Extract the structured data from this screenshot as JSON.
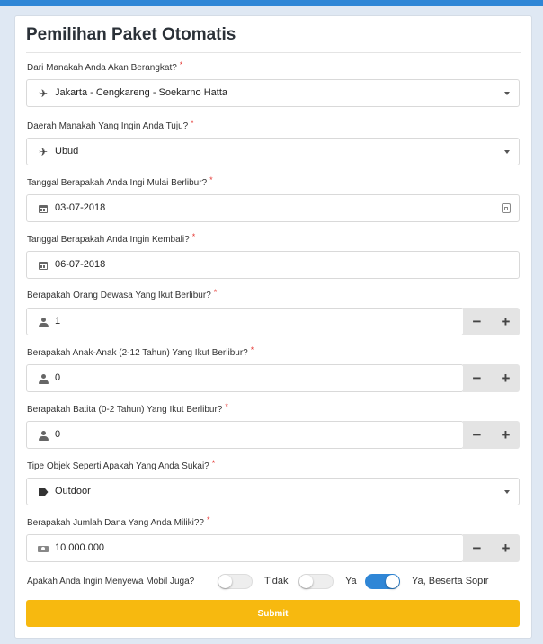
{
  "title": "Pemilihan Paket Otomatis",
  "required_mark": "*",
  "fields": {
    "departure": {
      "label": "Dari Manakah Anda Akan Berangkat?",
      "value": "Jakarta - Cengkareng - Soekarno Hatta",
      "icon": "plane-icon"
    },
    "destination": {
      "label": "Daerah Manakah Yang Ingin Anda Tuju?",
      "value": "Ubud",
      "icon": "plane-icon"
    },
    "start_date": {
      "label": "Tanggal Berapakah Anda Ingi Mulai Berlibur?",
      "value": "03-07-2018",
      "icon": "calendar-icon"
    },
    "end_date": {
      "label": "Tanggal Berapakah Anda Ingin Kembali?",
      "value": "06-07-2018",
      "icon": "calendar-icon"
    },
    "adults": {
      "label": "Berapakah Orang Dewasa Yang Ikut Berlibur?",
      "value": "1",
      "icon": "user-icon"
    },
    "children": {
      "label": "Berapakah Anak-Anak (2-12 Tahun) Yang Ikut Berlibur?",
      "value": "0",
      "icon": "user-icon"
    },
    "infants": {
      "label": "Berapakah Batita (0-2 Tahun) Yang Ikut Berlibur?",
      "value": "0",
      "icon": "user-icon"
    },
    "object_type": {
      "label": "Tipe Objek Seperti Apakah Yang Anda Sukai?",
      "value": "Outdoor",
      "icon": "tag-icon"
    },
    "budget": {
      "label": "Berapakah Jumlah Dana Yang Anda Miliki??",
      "value": "10.000.000",
      "icon": "money-icon"
    }
  },
  "stepper": {
    "minus": "−",
    "plus": "+"
  },
  "car_rental": {
    "question": "Apakah Anda Ingin Menyewa Mobil Juga?",
    "options": [
      {
        "label": "Tidak",
        "on": false
      },
      {
        "label": "Ya",
        "on": false
      },
      {
        "label": "Ya, Beserta Sopir",
        "on": true
      }
    ]
  },
  "submit_label": "Submit",
  "colors": {
    "accent": "#2f86d6",
    "submit": "#f7b90f",
    "required": "#e53935"
  }
}
